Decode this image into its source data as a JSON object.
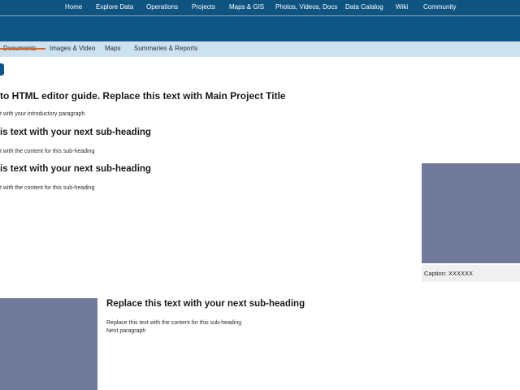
{
  "topnav": {
    "items": [
      "Home",
      "Explore Data",
      "Operations",
      "Projects",
      "Maps & GIS",
      "Photos, Videos, Docs",
      "Data Catalog",
      "Wiki",
      "Community"
    ]
  },
  "subnav": {
    "items": [
      "Documents",
      "Images & Video",
      "Maps",
      "Summaries & Reports"
    ],
    "active_index": 0
  },
  "content": {
    "main_title": "to HTML editor guide. Replace this text with Main Project Title",
    "intro": "t with your introductory paragraph",
    "section1": {
      "heading": "is text with your next sub-heading",
      "body": "t with the content for this sub-heading"
    },
    "section2": {
      "heading": "is text with your next sub-heading",
      "body": "t with the content for this sub-heading"
    },
    "caption": "Caption: XXXXXX",
    "section3": {
      "heading": "Replace this text with your next sub-heading",
      "body": "Replace this text with the content for this sub-heading",
      "next": "Next paragraph"
    }
  },
  "colors": {
    "nav_bg": "#0f5481",
    "banner_bg": "#0e5686",
    "subnav_bg": "#cde2ee",
    "active_underline": "#e8611f",
    "image_placeholder": "#727a9c"
  }
}
